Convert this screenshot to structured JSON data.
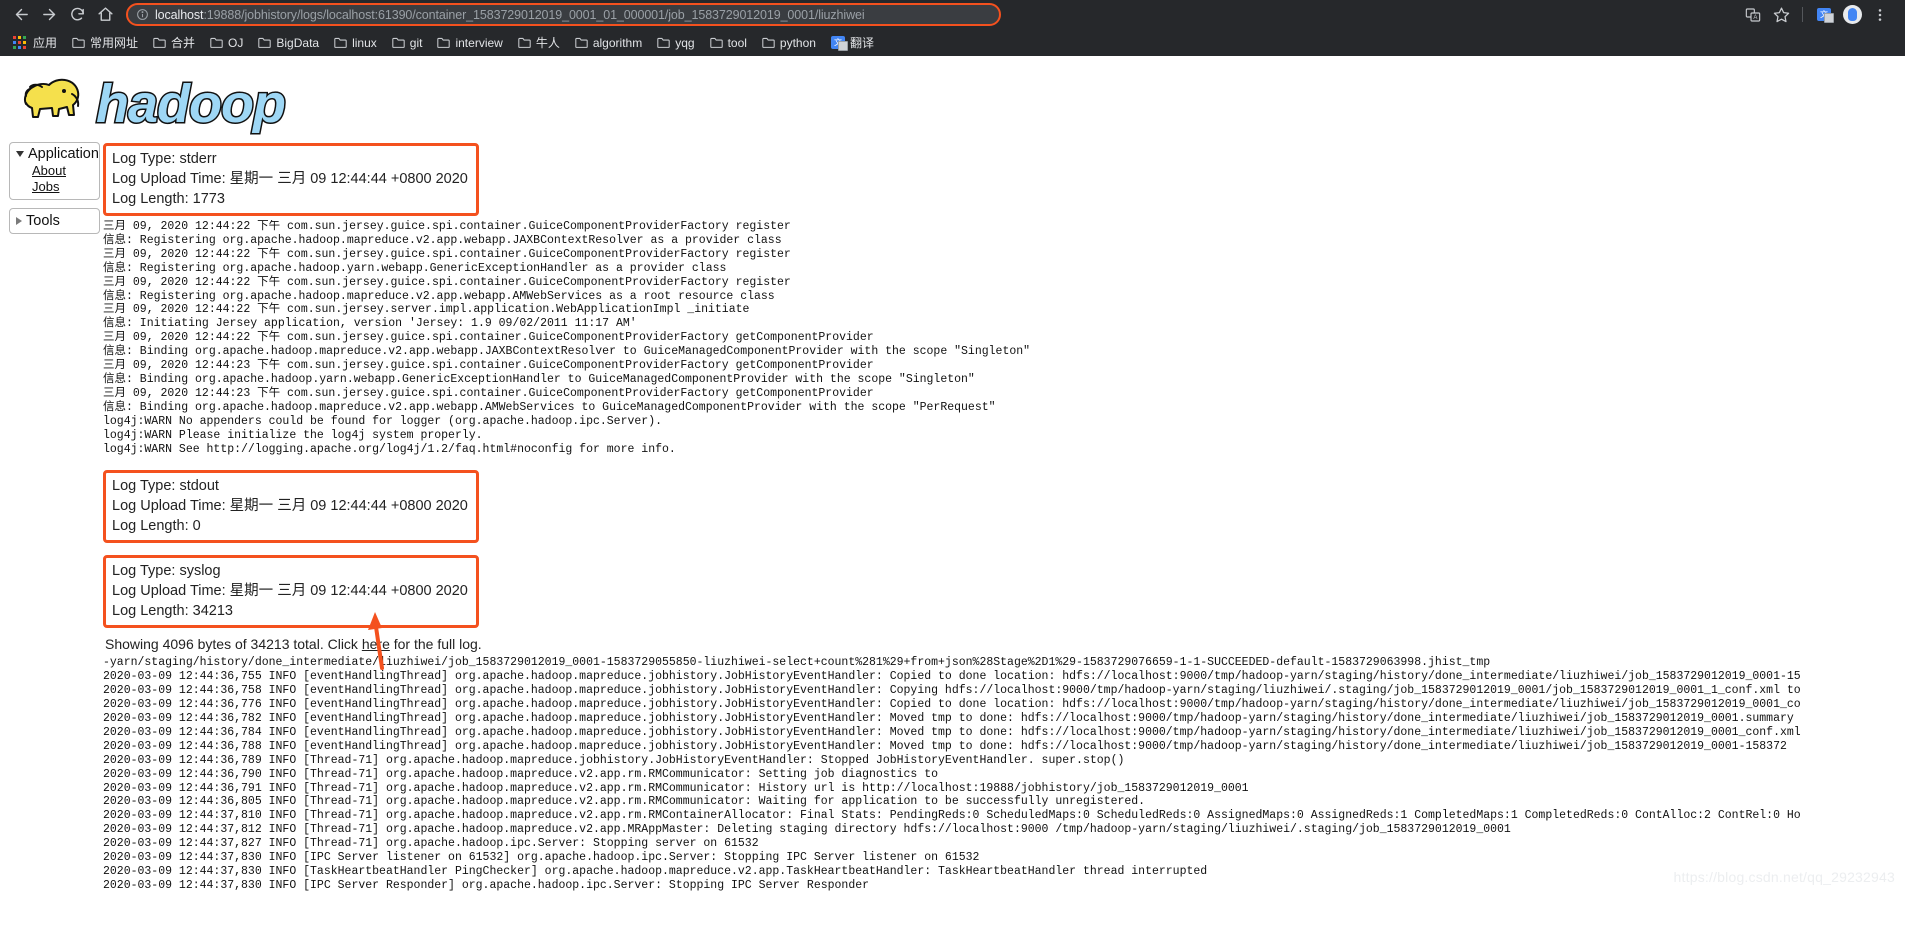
{
  "browser": {
    "nav": {
      "back_icon": "back-arrow-icon",
      "forward_icon": "forward-arrow-icon",
      "reload_icon": "reload-icon",
      "home_icon": "home-icon"
    },
    "omnibox": {
      "info_icon": "page-info-icon",
      "host": "localhost",
      "path": ":19888/jobhistory/logs/localhost:61390/container_1583729012019_0001_01_000001/job_1583729012019_0001/liuzhiwei",
      "full_url": "localhost:19888/jobhistory/logs/localhost:61390/container_1583729012019_0001_01_000001/job_1583729012019_0001/liuzhiwei",
      "highlight_color": "#f4511e"
    },
    "toolbar_right": [
      {
        "name": "translate-icon",
        "glyph": "文A"
      },
      {
        "name": "bookmark-star-icon",
        "glyph": "☆"
      },
      {
        "name": "google-translate-extension-icon",
        "glyph": "G"
      },
      {
        "name": "profile-avatar",
        "glyph": ""
      },
      {
        "name": "chrome-menu-icon",
        "glyph": "⋮"
      }
    ],
    "bookmarks": [
      {
        "label": "应用",
        "icon": "apps-grid-icon"
      },
      {
        "label": "常用网址",
        "icon": "folder-icon"
      },
      {
        "label": "合并",
        "icon": "folder-icon"
      },
      {
        "label": "OJ",
        "icon": "folder-icon"
      },
      {
        "label": "BigData",
        "icon": "folder-icon"
      },
      {
        "label": "linux",
        "icon": "folder-icon"
      },
      {
        "label": "git",
        "icon": "folder-icon"
      },
      {
        "label": "interview",
        "icon": "folder-icon"
      },
      {
        "label": "牛人",
        "icon": "folder-icon"
      },
      {
        "label": "algorithm",
        "icon": "folder-icon"
      },
      {
        "label": "yqg",
        "icon": "folder-icon"
      },
      {
        "label": "tool",
        "icon": "folder-icon"
      },
      {
        "label": "python",
        "icon": "folder-icon"
      },
      {
        "label": "翻译",
        "icon": "google-translate-icon"
      }
    ]
  },
  "page": {
    "logo_alt": "hadoop",
    "sidebar": {
      "groups": [
        {
          "title": "Application",
          "expanded": true,
          "items": [
            {
              "label": "About"
            },
            {
              "label": "Jobs"
            }
          ]
        },
        {
          "title": "Tools",
          "expanded": false,
          "items": []
        }
      ]
    },
    "logs": [
      {
        "type_label": "Log Type: stderr",
        "upload_label": "Log Upload Time: 星期一 三月 09 12:44:44 +0800 2020",
        "length_label": "Log Length: 1773",
        "body": "三月 09, 2020 12:44:22 下午 com.sun.jersey.guice.spi.container.GuiceComponentProviderFactory register\n信息: Registering org.apache.hadoop.mapreduce.v2.app.webapp.JAXBContextResolver as a provider class\n三月 09, 2020 12:44:22 下午 com.sun.jersey.guice.spi.container.GuiceComponentProviderFactory register\n信息: Registering org.apache.hadoop.yarn.webapp.GenericExceptionHandler as a provider class\n三月 09, 2020 12:44:22 下午 com.sun.jersey.guice.spi.container.GuiceComponentProviderFactory register\n信息: Registering org.apache.hadoop.mapreduce.v2.app.webapp.AMWebServices as a root resource class\n三月 09, 2020 12:44:22 下午 com.sun.jersey.server.impl.application.WebApplicationImpl _initiate\n信息: Initiating Jersey application, version 'Jersey: 1.9 09/02/2011 11:17 AM'\n三月 09, 2020 12:44:22 下午 com.sun.jersey.guice.spi.container.GuiceComponentProviderFactory getComponentProvider\n信息: Binding org.apache.hadoop.mapreduce.v2.app.webapp.JAXBContextResolver to GuiceManagedComponentProvider with the scope \"Singleton\"\n三月 09, 2020 12:44:23 下午 com.sun.jersey.guice.spi.container.GuiceComponentProviderFactory getComponentProvider\n信息: Binding org.apache.hadoop.yarn.webapp.GenericExceptionHandler to GuiceManagedComponentProvider with the scope \"Singleton\"\n三月 09, 2020 12:44:23 下午 com.sun.jersey.guice.spi.container.GuiceComponentProviderFactory getComponentProvider\n信息: Binding org.apache.hadoop.mapreduce.v2.app.webapp.AMWebServices to GuiceManagedComponentProvider with the scope \"PerRequest\"\nlog4j:WARN No appenders could be found for logger (org.apache.hadoop.ipc.Server).\nlog4j:WARN Please initialize the log4j system properly.\nlog4j:WARN See http://logging.apache.org/log4j/1.2/faq.html#noconfig for more info."
      },
      {
        "type_label": "Log Type: stdout",
        "upload_label": "Log Upload Time: 星期一 三月 09 12:44:44 +0800 2020",
        "length_label": "Log Length: 0",
        "body": ""
      },
      {
        "type_label": "Log Type: syslog",
        "upload_label": "Log Upload Time: 星期一 三月 09 12:44:44 +0800 2020",
        "length_label": "Log Length: 34213",
        "showing_prefix": "Showing 4096 bytes of 34213 total. Click ",
        "showing_link": "here",
        "showing_suffix": " for the full log.",
        "body": "-yarn/staging/history/done_intermediate/liuzhiwei/job_1583729012019_0001-1583729055850-liuzhiwei-select+count%281%29+from+json%28Stage%2D1%29-1583729076659-1-1-SUCCEEDED-default-1583729063998.jhist_tmp\n2020-03-09 12:44:36,755 INFO [eventHandlingThread] org.apache.hadoop.mapreduce.jobhistory.JobHistoryEventHandler: Copied to done location: hdfs://localhost:9000/tmp/hadoop-yarn/staging/history/done_intermediate/liuzhiwei/job_1583729012019_0001-15\n2020-03-09 12:44:36,758 INFO [eventHandlingThread] org.apache.hadoop.mapreduce.jobhistory.JobHistoryEventHandler: Copying hdfs://localhost:9000/tmp/hadoop-yarn/staging/liuzhiwei/.staging/job_1583729012019_0001/job_1583729012019_0001_1_conf.xml to\n2020-03-09 12:44:36,776 INFO [eventHandlingThread] org.apache.hadoop.mapreduce.jobhistory.JobHistoryEventHandler: Copied to done location: hdfs://localhost:9000/tmp/hadoop-yarn/staging/history/done_intermediate/liuzhiwei/job_1583729012019_0001_co\n2020-03-09 12:44:36,782 INFO [eventHandlingThread] org.apache.hadoop.mapreduce.jobhistory.JobHistoryEventHandler: Moved tmp to done: hdfs://localhost:9000/tmp/hadoop-yarn/staging/history/done_intermediate/liuzhiwei/job_1583729012019_0001.summary\n2020-03-09 12:44:36,784 INFO [eventHandlingThread] org.apache.hadoop.mapreduce.jobhistory.JobHistoryEventHandler: Moved tmp to done: hdfs://localhost:9000/tmp/hadoop-yarn/staging/history/done_intermediate/liuzhiwei/job_1583729012019_0001_conf.xml\n2020-03-09 12:44:36,788 INFO [eventHandlingThread] org.apache.hadoop.mapreduce.jobhistory.JobHistoryEventHandler: Moved tmp to done: hdfs://localhost:9000/tmp/hadoop-yarn/staging/history/done_intermediate/liuzhiwei/job_1583729012019_0001-158372\n2020-03-09 12:44:36,789 INFO [Thread-71] org.apache.hadoop.mapreduce.jobhistory.JobHistoryEventHandler: Stopped JobHistoryEventHandler. super.stop()\n2020-03-09 12:44:36,790 INFO [Thread-71] org.apache.hadoop.mapreduce.v2.app.rm.RMCommunicator: Setting job diagnostics to\n2020-03-09 12:44:36,791 INFO [Thread-71] org.apache.hadoop.mapreduce.v2.app.rm.RMCommunicator: History url is http://localhost:19888/jobhistory/job_1583729012019_0001\n2020-03-09 12:44:36,805 INFO [Thread-71] org.apache.hadoop.mapreduce.v2.app.rm.RMCommunicator: Waiting for application to be successfully unregistered.\n2020-03-09 12:44:37,810 INFO [Thread-71] org.apache.hadoop.mapreduce.v2.app.rm.RMContainerAllocator: Final Stats: PendingReds:0 ScheduledMaps:0 ScheduledReds:0 AssignedMaps:0 AssignedReds:1 CompletedMaps:1 CompletedReds:0 ContAlloc:2 ContRel:0 Ho\n2020-03-09 12:44:37,812 INFO [Thread-71] org.apache.hadoop.mapreduce.v2.app.MRAppMaster: Deleting staging directory hdfs://localhost:9000 /tmp/hadoop-yarn/staging/liuzhiwei/.staging/job_1583729012019_0001\n2020-03-09 12:44:37,827 INFO [Thread-71] org.apache.hadoop.ipc.Server: Stopping server on 61532\n2020-03-09 12:44:37,830 INFO [IPC Server listener on 61532] org.apache.hadoop.ipc.Server: Stopping IPC Server listener on 61532\n2020-03-09 12:44:37,830 INFO [TaskHeartbeatHandler PingChecker] org.apache.hadoop.mapreduce.v2.app.TaskHeartbeatHandler: TaskHeartbeatHandler thread interrupted\n2020-03-09 12:44:37,830 INFO [IPC Server Responder] org.apache.hadoop.ipc.Server: Stopping IPC Server Responder"
      }
    ],
    "watermark": "https://blog.csdn.net/qq_29232943",
    "annotation_arrow_color": "#f4511e"
  }
}
